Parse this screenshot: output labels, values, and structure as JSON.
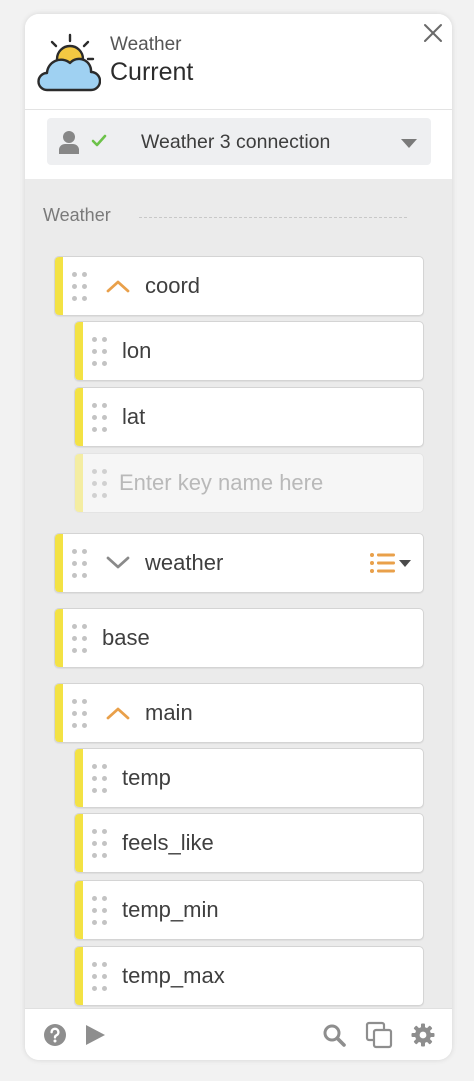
{
  "header": {
    "app_label": "Weather",
    "app_title": "Current",
    "icons": {
      "app": "sun-cloud-icon",
      "close": "close-icon"
    }
  },
  "connection": {
    "label": "Weather 3 connection",
    "icons": [
      "user-icon",
      "check-icon",
      "chevron-down-icon"
    ]
  },
  "section": {
    "title": "Weather"
  },
  "nodes": {
    "coord": {
      "label": "coord",
      "state": "expanded"
    },
    "lon": {
      "label": "lon"
    },
    "lat": {
      "label": "lat"
    },
    "key_input": {
      "placeholder": "Enter key name here",
      "value": ""
    },
    "weather": {
      "label": "weather",
      "state": "collapsed",
      "menu_icon": "list-menu-icon"
    },
    "base": {
      "label": "base"
    },
    "main": {
      "label": "main",
      "state": "expanded"
    },
    "temp": {
      "label": "temp"
    },
    "feels_like": {
      "label": "feels_like"
    },
    "temp_min": {
      "label": "temp_min"
    },
    "temp_max": {
      "label": "temp_max"
    }
  },
  "footer": {
    "icons": [
      "help-icon",
      "play-icon",
      "search-icon",
      "copy-icon",
      "gear-icon"
    ]
  },
  "colors": {
    "accent_yellow": "#f3e244",
    "toggle_orange": "#e9a04a",
    "check_green": "#6cc24a",
    "icon_gray": "#8e8e8e"
  }
}
